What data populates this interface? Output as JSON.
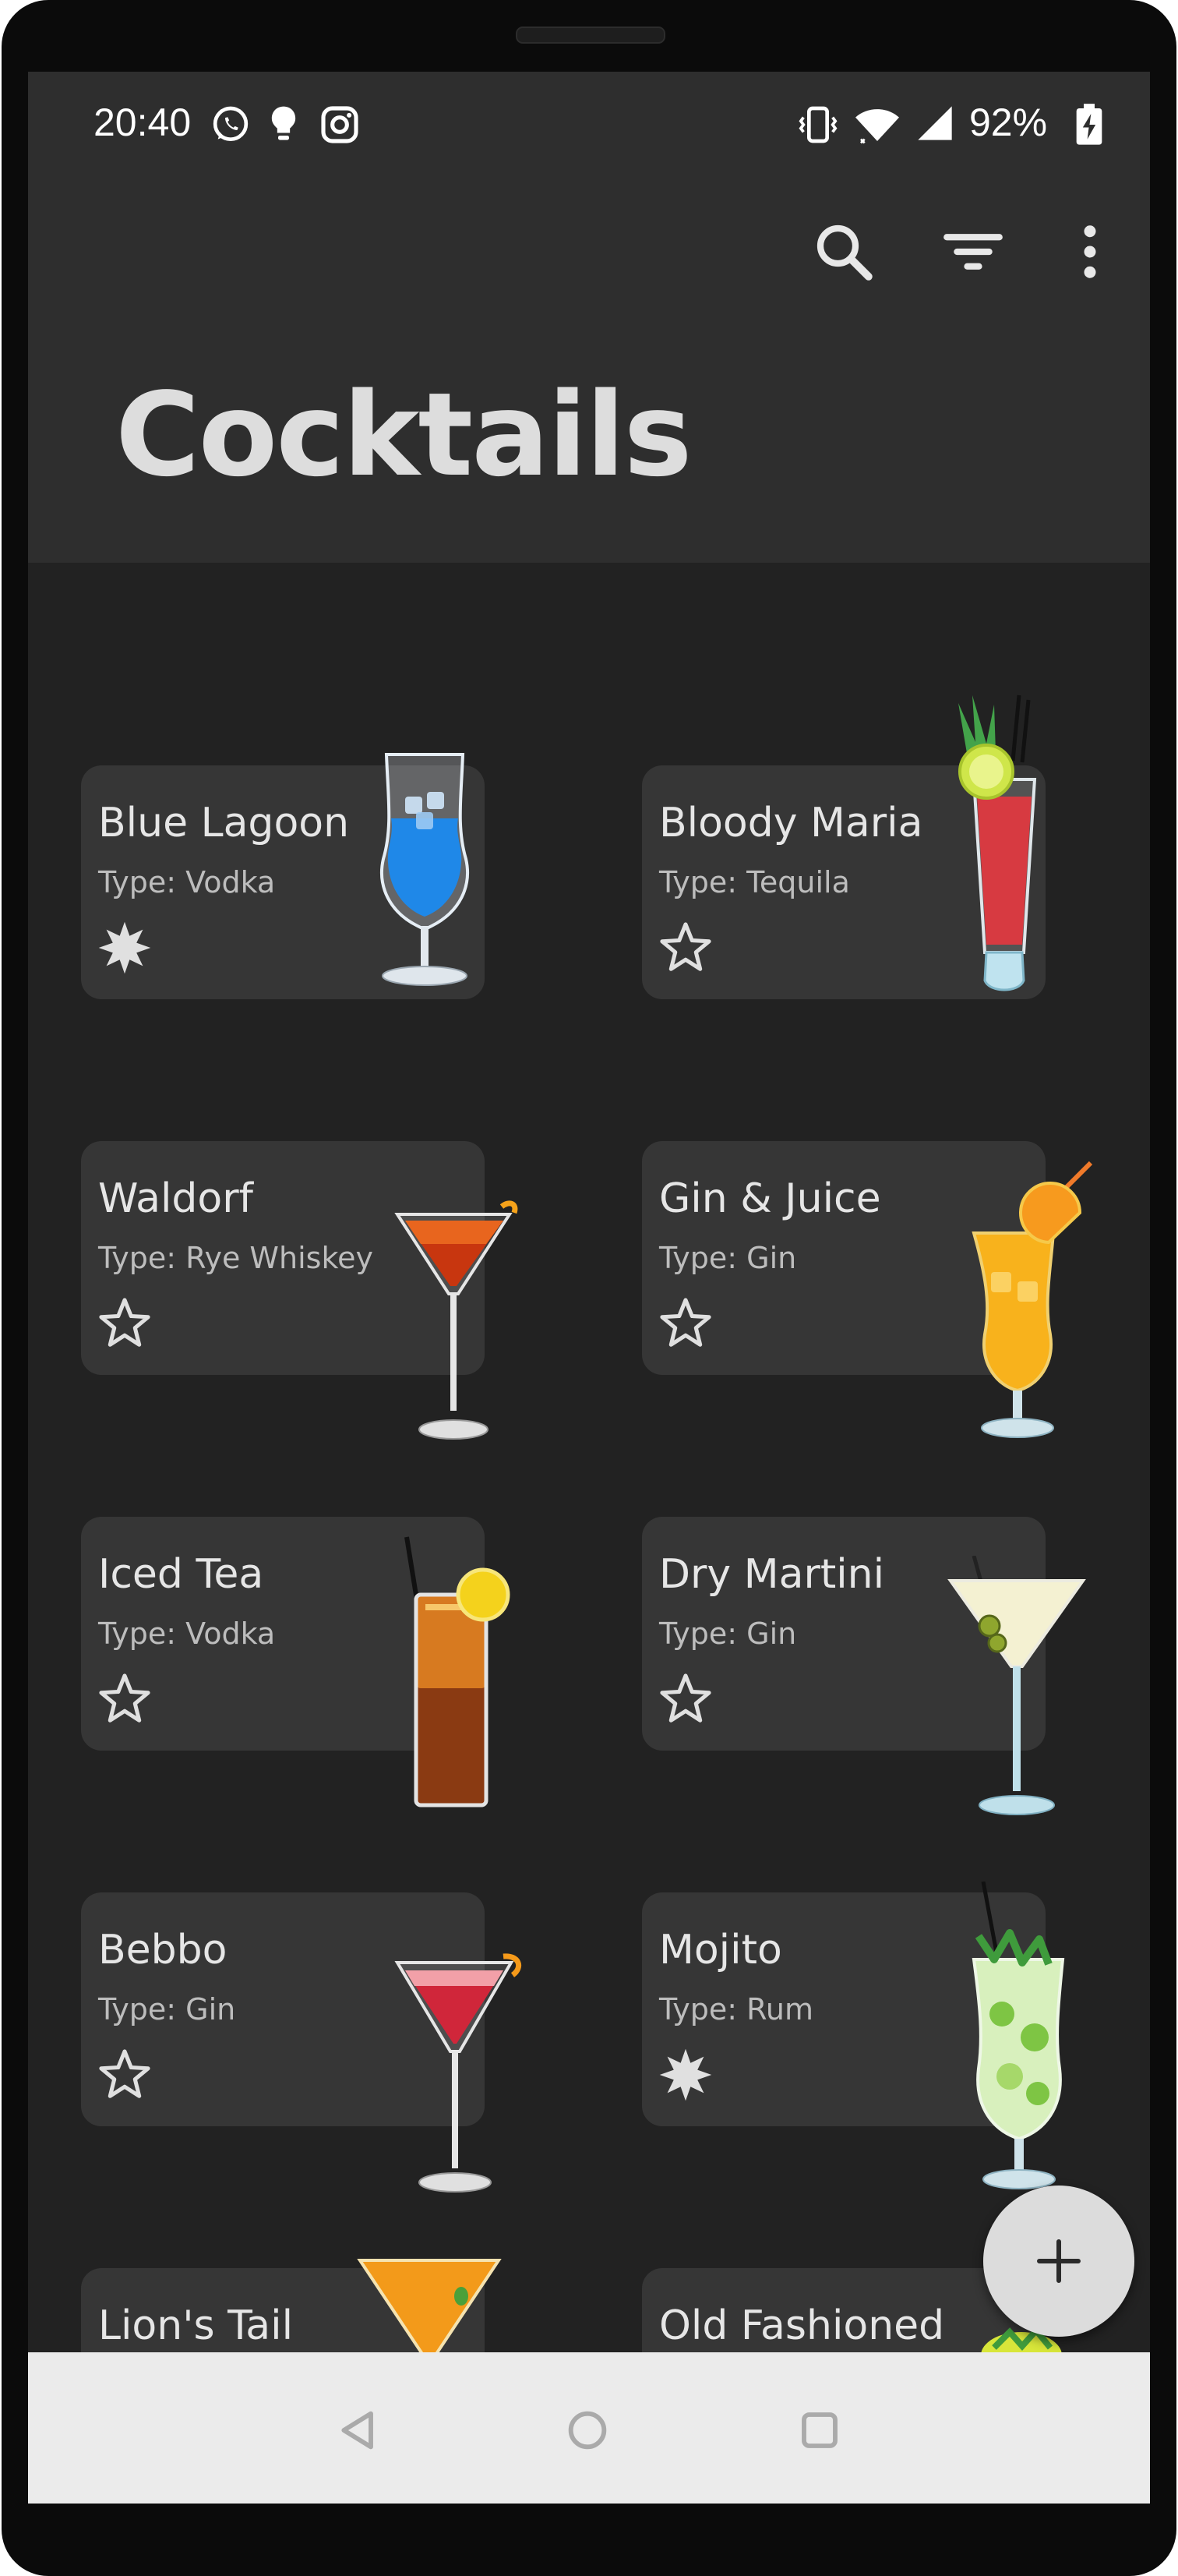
{
  "status_bar": {
    "time": "20:40",
    "battery": "92%",
    "left_icons": [
      "whatsapp-icon",
      "bulb-icon",
      "instagram-icon"
    ],
    "right_icons": [
      "vibrate-icon",
      "wifi-icon",
      "signal-icon",
      "battery-charging-icon"
    ]
  },
  "toolbar": {
    "title": "Cocktails",
    "actions": [
      "search-icon",
      "filter-icon",
      "more-vert-icon"
    ]
  },
  "cocktails": [
    {
      "name": "Blue Lagoon",
      "type": "Type: Vodka",
      "favorite": true
    },
    {
      "name": "Bloody Maria",
      "type": "Type: Tequila",
      "favorite": false
    },
    {
      "name": "Waldorf",
      "type": "Type: Rye Whiskey",
      "favorite": false
    },
    {
      "name": "Gin & Juice",
      "type": "Type: Gin",
      "favorite": false
    },
    {
      "name": "Iced Tea",
      "type": "Type: Vodka",
      "favorite": false
    },
    {
      "name": "Dry Martini",
      "type": "Type: Gin",
      "favorite": false
    },
    {
      "name": "Bebbo",
      "type": "Type: Gin",
      "favorite": false
    },
    {
      "name": "Mojito",
      "type": "Type: Rum",
      "favorite": true
    },
    {
      "name": "Lion's Tail",
      "type": "",
      "favorite": false
    },
    {
      "name": "Old Fashioned",
      "type": "",
      "favorite": false
    }
  ],
  "fab": {
    "icon": "plus-icon"
  },
  "nav_bar": {
    "icons": [
      "back-icon",
      "home-icon",
      "recents-icon"
    ]
  },
  "colors": {
    "background": "#222222",
    "app_bar": "#2e2e2e",
    "card": "#363636",
    "fab": "#dcdcdc"
  }
}
